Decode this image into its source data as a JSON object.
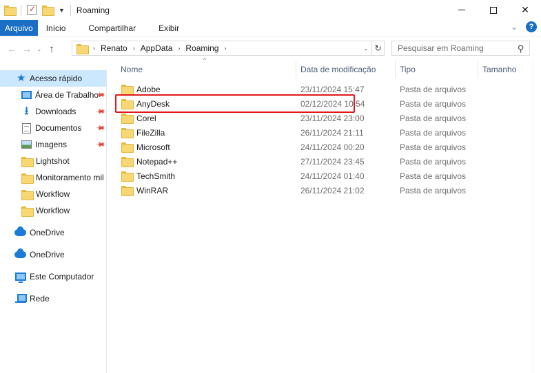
{
  "window": {
    "title": "Roaming",
    "close_glyph": "✕"
  },
  "ribbon": {
    "tabs": [
      {
        "label": "Arquivo"
      },
      {
        "label": "Início"
      },
      {
        "label": "Compartilhar"
      },
      {
        "label": "Exibir"
      }
    ],
    "collapse_glyph": "⌄",
    "help_glyph": "?"
  },
  "navigation": {
    "back_glyph": "←",
    "forward_glyph": "→",
    "recent_glyph": "⌄",
    "up_glyph": "↑"
  },
  "address": {
    "crumbs": [
      "Renato",
      "AppData",
      "Roaming"
    ],
    "separator": "›",
    "dropdown_glyph": "⌄",
    "refresh_glyph": "↻"
  },
  "search": {
    "placeholder": "Pesquisar em Roaming",
    "icon_glyph": "⚲"
  },
  "sidebar": {
    "quick_access": {
      "label": "Acesso rápido",
      "icon": "star-icon",
      "glyph": "★"
    },
    "items": [
      {
        "label": "Área de Trabalho",
        "pinned": true,
        "icon": "desktop-icon"
      },
      {
        "label": "Downloads",
        "pinned": true,
        "icon": "download-icon",
        "glyph": "⭳"
      },
      {
        "label": "Documentos",
        "pinned": true,
        "icon": "documents-icon"
      },
      {
        "label": "Imagens",
        "pinned": true,
        "icon": "images-icon"
      },
      {
        "label": "Lightshot",
        "pinned": false,
        "icon": "folder-icon"
      },
      {
        "label": "Monitoramento mil",
        "pinned": false,
        "icon": "folder-icon"
      },
      {
        "label": "Workflow",
        "pinned": false,
        "icon": "folder-icon"
      },
      {
        "label": "Workflow",
        "pinned": false,
        "icon": "folder-icon"
      }
    ],
    "pin_glyph": "📌",
    "onedrive": [
      {
        "label": "OneDrive",
        "icon": "onedrive-icon"
      },
      {
        "label": "OneDrive",
        "icon": "onedrive-icon"
      }
    ],
    "computer": {
      "label": "Este Computador",
      "icon": "computer-icon"
    },
    "network": {
      "label": "Rede",
      "icon": "network-icon"
    }
  },
  "files": {
    "columns": [
      {
        "label": "Nome"
      },
      {
        "label": "Data de modificação"
      },
      {
        "label": "Tipo"
      },
      {
        "label": "Tamanho"
      }
    ],
    "sort_glyph": "^",
    "rows": [
      {
        "name": "Adobe",
        "date": "23/11/2024 15:47",
        "type": "Pasta de arquivos"
      },
      {
        "name": "AnyDesk",
        "date": "02/12/2024 10:54",
        "type": "Pasta de arquivos"
      },
      {
        "name": "Corel",
        "date": "23/11/2024 23:00",
        "type": "Pasta de arquivos"
      },
      {
        "name": "FileZilla",
        "date": "26/11/2024 21:11",
        "type": "Pasta de arquivos"
      },
      {
        "name": "Microsoft",
        "date": "24/11/2024 00:20",
        "type": "Pasta de arquivos"
      },
      {
        "name": "Notepad++",
        "date": "27/11/2024 23:45",
        "type": "Pasta de arquivos"
      },
      {
        "name": "TechSmith",
        "date": "24/11/2024 01:40",
        "type": "Pasta de arquivos"
      },
      {
        "name": "WinRAR",
        "date": "26/11/2024 21:02",
        "type": "Pasta de arquivos"
      }
    ],
    "highlighted_row": "AnyDesk",
    "highlight_color": "#e0191b"
  },
  "colors": {
    "accent": "#1a6fc4",
    "selection": "#cce8ff",
    "folder": "#f8d775"
  }
}
